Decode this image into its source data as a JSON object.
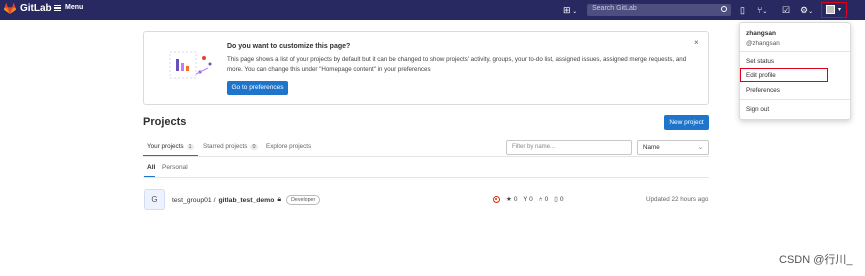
{
  "nav": {
    "brand": "GitLab",
    "menu_label": "Menu",
    "search_placeholder": "Search GitLab"
  },
  "banner": {
    "title": "Do you want to customize this page?",
    "text": "This page shows a list of your projects by default but it can be changed to show projects' activity, groups, your to-do list, assigned issues, assigned merge requests, and more. You can change this under \"Homepage content\" in your preferences",
    "button": "Go to preferences",
    "close": "×"
  },
  "projects": {
    "title": "Projects",
    "new_button": "New project",
    "tabs": [
      {
        "label": "Your projects",
        "count": "1"
      },
      {
        "label": "Starred projects",
        "count": "0"
      },
      {
        "label": "Explore projects",
        "count": ""
      }
    ],
    "filter_placeholder": "Filter by name...",
    "sort_value": "Name",
    "subtabs": [
      "All",
      "Personal"
    ],
    "list": [
      {
        "avatar_letter": "G",
        "namespace": "test_group01 / ",
        "name": "gitlab_test_demo",
        "role": "Developer",
        "stars": "0",
        "forks": "0",
        "merge_requests": "0",
        "issues": "0",
        "updated": "Updated 22 hours ago"
      }
    ]
  },
  "user_menu": {
    "name": "zhangsan",
    "username": "@zhangsan",
    "items": [
      "Set status",
      "Edit profile",
      "Preferences",
      "Sign out"
    ]
  },
  "watermark": "CSDN @行川_",
  "colors": {
    "navbar": "#292961",
    "primary": "#1f75cb",
    "highlight": "#e0001b"
  }
}
